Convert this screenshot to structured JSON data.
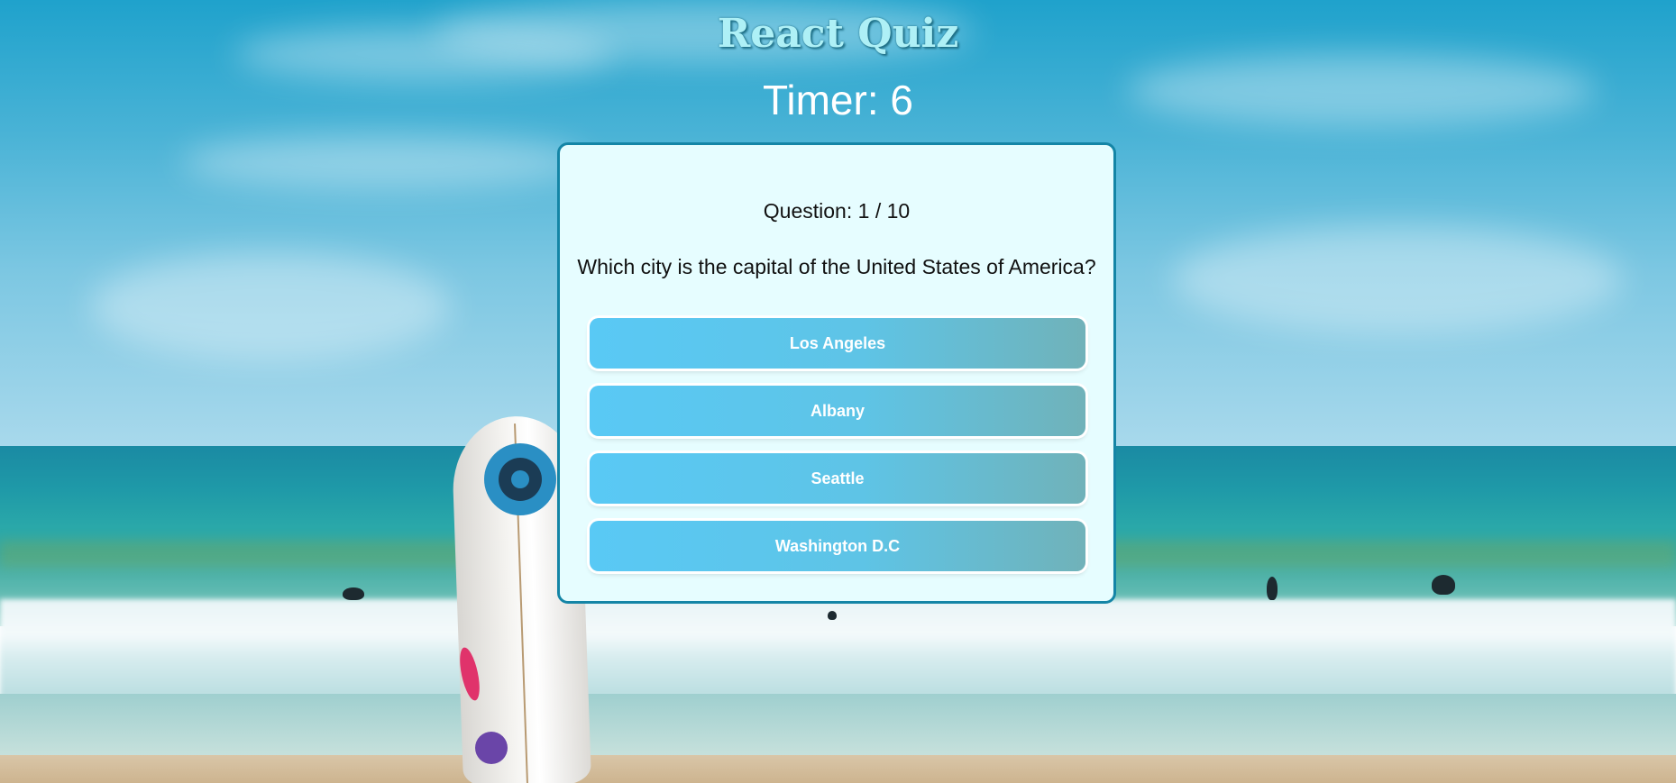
{
  "app": {
    "title": "React Quiz"
  },
  "timer": {
    "label": "Timer: 6",
    "seconds": 6
  },
  "quiz": {
    "question_count": "Question: 1 / 10",
    "current_question": 1,
    "total_questions": 10,
    "question_text": "Which city is the capital of the United States of America?",
    "answers": [
      {
        "label": "Los Angeles"
      },
      {
        "label": "Albany"
      },
      {
        "label": "Seattle"
      },
      {
        "label": "Washington D.C"
      }
    ]
  },
  "colors": {
    "title": "#aef0f6",
    "card_background": "#e6fdff",
    "card_border": "#1485a6",
    "button_gradient_start": "#59c9f5",
    "button_gradient_end": "#70b2b9"
  },
  "background": {
    "image": "beach-surfboard-photo"
  }
}
